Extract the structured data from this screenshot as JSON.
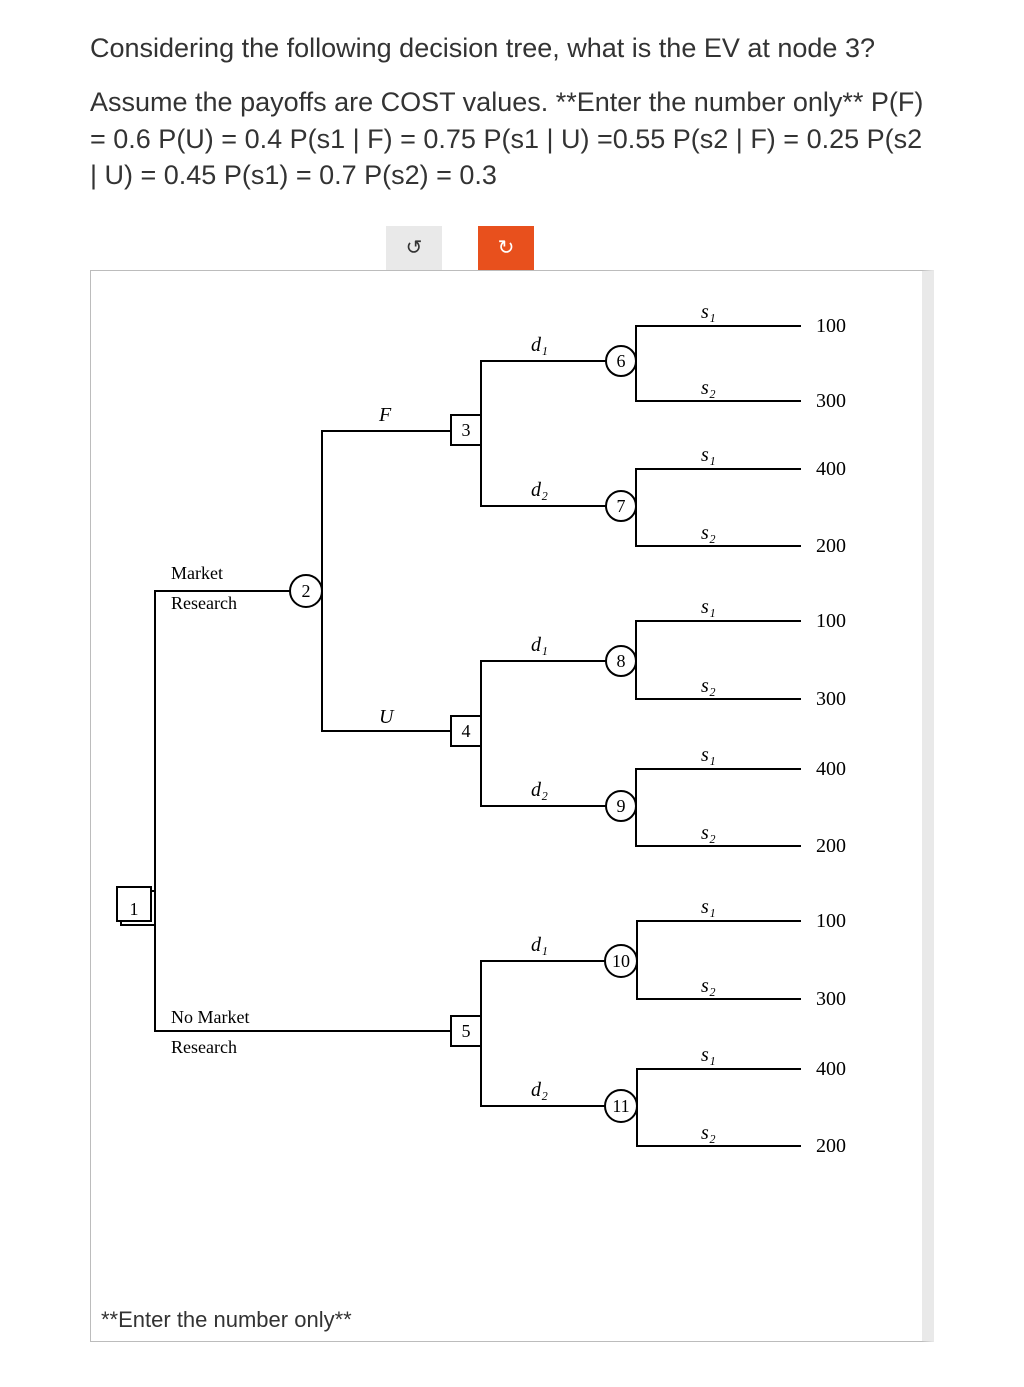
{
  "question_line1": "Considering the following decision tree, what is the EV at node 3?",
  "assume_line": "Assume the payoffs are COST values. **Enter the number only** P(F) = 0.6 P(U) = 0.4 P(s1 | F) = 0.75 P(s1 | U) =0.55 P(s2 | F) = 0.25 P(s2 | U) = 0.45 P(s1) = 0.7 P(s2) = 0.3",
  "buttons": {
    "undo": "↺",
    "redo": "↻"
  },
  "labels": {
    "market": "Market",
    "research": "Research",
    "nomarket": "No Market",
    "F": "F",
    "U": "U",
    "d1": "d₁",
    "d2": "d₂",
    "s1": "s₁",
    "s2": "s₂"
  },
  "nodes": {
    "n1": "1",
    "n2": "2",
    "n3": "3",
    "n4": "4",
    "n5": "5",
    "n6": "6",
    "n7": "7",
    "n8": "8",
    "n9": "9",
    "n10": "10",
    "n11": "11"
  },
  "payoffs": {
    "p6s1": "100",
    "p6s2": "300",
    "p7s1": "400",
    "p7s2": "200",
    "p8s1": "100",
    "p8s2": "300",
    "p9s1": "400",
    "p9s2": "200",
    "p10s1": "100",
    "p10s2": "300",
    "p11s1": "400",
    "p11s2": "200"
  },
  "footnote": "**Enter the number only**"
}
